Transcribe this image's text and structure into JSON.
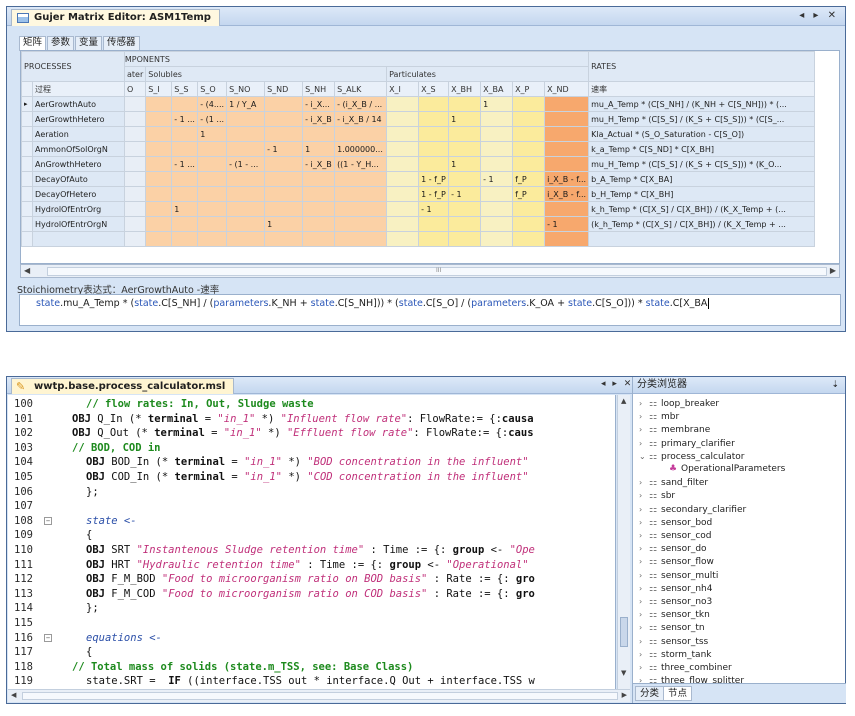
{
  "matrix_editor": {
    "title": "Gujer Matrix Editor: ASM1Temp",
    "window_controls": "◂ ▸ ✕",
    "tabs": [
      "矩阵",
      "参数",
      "变量",
      "传感器"
    ],
    "header_components": "COMPONENTS",
    "header_processes": "PROCESSES",
    "header_rates": "RATES",
    "group_water": "ater",
    "group_solubles": "Solubles",
    "group_particulates": "Particulates",
    "process_col_label": "过程",
    "rate_col_label": "速率",
    "columns": [
      "O",
      "S_I",
      "S_S",
      "S_O",
      "S_NO",
      "S_ND",
      "S_NH",
      "S_ALK",
      "X_I",
      "X_S",
      "X_BH",
      "X_BA",
      "X_P",
      "X_ND"
    ],
    "rows": [
      {
        "process": "AerGrowthAuto",
        "cells": [
          "",
          "",
          "",
          "- (4....",
          "1 / Y_A",
          "",
          "- i_X...",
          "- (i_X_B / ...",
          "",
          "",
          "",
          "1",
          "",
          ""
        ],
        "rate": "mu_A_Temp * (C[S_NH] / (K_NH + C[S_NH])) * (...",
        "current": true
      },
      {
        "process": "AerGrowthHetero",
        "cells": [
          "",
          "",
          "- 1 ...",
          "- (1 ...",
          "",
          "",
          "- i_X_B",
          "- i_X_B / 14",
          "",
          "",
          "1",
          "",
          "",
          ""
        ],
        "rate": "mu_H_Temp * (C[S_S] / (K_S + C[S_S])) * (C[S_...",
        "current": false
      },
      {
        "process": "Aeration",
        "cells": [
          "",
          "",
          "",
          "1",
          "",
          "",
          "",
          "",
          "",
          "",
          "",
          "",
          "",
          ""
        ],
        "rate": "Kla_Actual * (S_O_Saturation - C[S_O])",
        "current": false
      },
      {
        "process": "AmmonOfSolOrgN",
        "cells": [
          "",
          "",
          "",
          "",
          "",
          "- 1",
          "1",
          "1.000000...",
          "",
          "",
          "",
          "",
          "",
          ""
        ],
        "rate": "k_a_Temp * C[S_ND] * C[X_BH]",
        "current": false
      },
      {
        "process": "AnGrowthHetero",
        "cells": [
          "",
          "",
          "- 1 ...",
          "",
          "- (1 - ...",
          "",
          "- i_X_B",
          "((1 - Y_H...",
          "",
          "",
          "1",
          "",
          "",
          ""
        ],
        "rate": "mu_H_Temp * (C[S_S] / (K_S + C[S_S])) * (K_O...",
        "current": false
      },
      {
        "process": "DecayOfAuto",
        "cells": [
          "",
          "",
          "",
          "",
          "",
          "",
          "",
          "",
          "",
          "1 - f_P",
          "",
          "- 1",
          "f_P",
          "i_X_B - f..."
        ],
        "rate": "b_A_Temp * C[X_BA]",
        "current": false
      },
      {
        "process": "DecayOfHetero",
        "cells": [
          "",
          "",
          "",
          "",
          "",
          "",
          "",
          "",
          "",
          "1 - f_P",
          "- 1",
          "",
          "f_P",
          "i_X_B - f..."
        ],
        "rate": "b_H_Temp * C[X_BH]",
        "current": false
      },
      {
        "process": "HydrolOfEntrOrg",
        "cells": [
          "",
          "",
          "1",
          "",
          "",
          "",
          "",
          "",
          "",
          "- 1",
          "",
          "",
          "",
          ""
        ],
        "rate": "k_h_Temp * (C[X_S] / C[X_BH]) / (K_X_Temp + (...",
        "current": false
      },
      {
        "process": "HydrolOfEntrOrgN",
        "cells": [
          "",
          "",
          "",
          "",
          "",
          "1",
          "",
          "",
          "",
          "",
          "",
          "",
          "",
          "- 1"
        ],
        "rate": "(k_h_Temp * (C[X_S] / C[X_BH]) / (K_X_Temp + ...",
        "current": false
      }
    ],
    "scroll_mark": "III",
    "stoich_label": "Stoichiometry表达式：AerGrowthAuto -速率",
    "formula_parts": [
      {
        "t": "state",
        "kw": true
      },
      {
        "t": ".mu_A_Temp * (",
        "kw": false
      },
      {
        "t": "state",
        "kw": true
      },
      {
        "t": ".C[S_NH] / (",
        "kw": false
      },
      {
        "t": "parameters",
        "kw": true
      },
      {
        "t": ".K_NH + ",
        "kw": false
      },
      {
        "t": "state",
        "kw": true
      },
      {
        "t": ".C[S_NH])) * (",
        "kw": false
      },
      {
        "t": "state",
        "kw": true
      },
      {
        "t": ".C[S_O] / (",
        "kw": false
      },
      {
        "t": "parameters",
        "kw": true
      },
      {
        "t": ".K_OA + ",
        "kw": false
      },
      {
        "t": "state",
        "kw": true
      },
      {
        "t": ".C[S_O])) * ",
        "kw": false
      },
      {
        "t": "state",
        "kw": true
      },
      {
        "t": ".C[X_BA",
        "kw": false
      }
    ]
  },
  "code_editor": {
    "file_tab": "wwtp.base.process_calculator.msl",
    "controls": "◂ ▸ ✕",
    "lines": [
      {
        "n": "100",
        "indent": 1,
        "fold": false,
        "segs": [
          [
            "cm",
            "// flow rates: In, Out, Sludge waste"
          ]
        ]
      },
      {
        "n": "101",
        "indent": 0,
        "fold": false,
        "segs": [
          [
            "k",
            "OBJ"
          ],
          [
            "pl",
            " Q_In (* "
          ],
          [
            "k",
            "terminal"
          ],
          [
            "pl",
            " = "
          ],
          [
            "st",
            "\"in_1\""
          ],
          [
            "pl",
            " *) "
          ],
          [
            "st",
            "\"Influent flow rate\""
          ],
          [
            "pl",
            ": FlowRate:= {:"
          ],
          [
            "k",
            "causa"
          ]
        ]
      },
      {
        "n": "102",
        "indent": 0,
        "fold": false,
        "segs": [
          [
            "k",
            "OBJ"
          ],
          [
            "pl",
            " Q_Out (* "
          ],
          [
            "k",
            "terminal"
          ],
          [
            "pl",
            " = "
          ],
          [
            "st",
            "\"in_1\""
          ],
          [
            "pl",
            " *) "
          ],
          [
            "st",
            "\"Effluent flow rate\""
          ],
          [
            "pl",
            ": FlowRate:= {:"
          ],
          [
            "k",
            "caus"
          ]
        ]
      },
      {
        "n": "103",
        "indent": 0,
        "fold": false,
        "segs": [
          [
            "cm",
            "// BOD, COD in"
          ]
        ]
      },
      {
        "n": "104",
        "indent": 1,
        "fold": false,
        "segs": [
          [
            "k",
            "OBJ"
          ],
          [
            "pl",
            " BOD_In (* "
          ],
          [
            "k",
            "terminal"
          ],
          [
            "pl",
            " = "
          ],
          [
            "st",
            "\"in_1\""
          ],
          [
            "pl",
            " *) "
          ],
          [
            "st",
            "\"BOD concentration in the influent\""
          ]
        ]
      },
      {
        "n": "105",
        "indent": 1,
        "fold": false,
        "segs": [
          [
            "k",
            "OBJ"
          ],
          [
            "pl",
            " COD_In (* "
          ],
          [
            "k",
            "terminal"
          ],
          [
            "pl",
            " = "
          ],
          [
            "st",
            "\"in_1\""
          ],
          [
            "pl",
            " *) "
          ],
          [
            "st",
            "\"COD concentration in the influent\""
          ]
        ]
      },
      {
        "n": "106",
        "indent": 1,
        "fold": false,
        "segs": [
          [
            "pl",
            "};"
          ]
        ]
      },
      {
        "n": "107",
        "indent": 0,
        "fold": false,
        "segs": []
      },
      {
        "n": "108",
        "indent": 1,
        "fold": true,
        "segs": [
          [
            "it",
            "state <-"
          ]
        ]
      },
      {
        "n": "109",
        "indent": 1,
        "fold": false,
        "segs": [
          [
            "pl",
            "{"
          ]
        ]
      },
      {
        "n": "110",
        "indent": 1,
        "fold": false,
        "segs": [
          [
            "k",
            "OBJ"
          ],
          [
            "pl",
            " SRT "
          ],
          [
            "st",
            "\"Instantenous Sludge retention time\""
          ],
          [
            "pl",
            " : Time := {: "
          ],
          [
            "k",
            "group"
          ],
          [
            "pl",
            " <- "
          ],
          [
            "st",
            "\"Ope"
          ]
        ]
      },
      {
        "n": "111",
        "indent": 1,
        "fold": false,
        "segs": [
          [
            "k",
            "OBJ"
          ],
          [
            "pl",
            " HRT "
          ],
          [
            "st",
            "\"Hydraulic retention time\""
          ],
          [
            "pl",
            " : Time := {: "
          ],
          [
            "k",
            "group"
          ],
          [
            "pl",
            " <- "
          ],
          [
            "st",
            "\"Operational\""
          ]
        ]
      },
      {
        "n": "112",
        "indent": 1,
        "fold": false,
        "segs": [
          [
            "k",
            "OBJ"
          ],
          [
            "pl",
            " F_M_BOD "
          ],
          [
            "st",
            "\"Food to microorganism ratio on BOD basis\""
          ],
          [
            "pl",
            " : Rate := {: "
          ],
          [
            "k",
            "gro"
          ]
        ]
      },
      {
        "n": "113",
        "indent": 1,
        "fold": false,
        "segs": [
          [
            "k",
            "OBJ"
          ],
          [
            "pl",
            " F_M_COD "
          ],
          [
            "st",
            "\"Food to microorganism ratio on COD basis\""
          ],
          [
            "pl",
            " : Rate := {: "
          ],
          [
            "k",
            "gro"
          ]
        ]
      },
      {
        "n": "114",
        "indent": 1,
        "fold": false,
        "segs": [
          [
            "pl",
            "};"
          ]
        ]
      },
      {
        "n": "115",
        "indent": 0,
        "fold": false,
        "segs": []
      },
      {
        "n": "116",
        "indent": 1,
        "fold": true,
        "segs": [
          [
            "it",
            "equations <-"
          ]
        ]
      },
      {
        "n": "117",
        "indent": 1,
        "fold": false,
        "segs": [
          [
            "pl",
            "{"
          ]
        ]
      },
      {
        "n": "118",
        "indent": 0,
        "fold": false,
        "segs": [
          [
            "cm",
            "// Total mass of solids (state.m_TSS, see: Base Class)"
          ]
        ]
      },
      {
        "n": "119",
        "indent": 1,
        "fold": false,
        "segs": [
          [
            "pl",
            "state.SRT =  "
          ],
          [
            "k",
            "IF"
          ],
          [
            "pl",
            " ((interface.TSS out * interface.Q Out + interface.TSS w"
          ]
        ]
      }
    ]
  },
  "class_browser": {
    "title": "分类浏览器",
    "pin": "⇣",
    "nodes": [
      {
        "label": "loop_breaker",
        "child": false,
        "expanded": false
      },
      {
        "label": "mbr",
        "child": false,
        "expanded": false
      },
      {
        "label": "membrane",
        "child": false,
        "expanded": false
      },
      {
        "label": "primary_clarifier",
        "child": false,
        "expanded": false
      },
      {
        "label": "process_calculator",
        "child": false,
        "expanded": true
      },
      {
        "label": "OperationalParameters",
        "child": true,
        "expanded": false
      },
      {
        "label": "sand_filter",
        "child": false,
        "expanded": false
      },
      {
        "label": "sbr",
        "child": false,
        "expanded": false
      },
      {
        "label": "secondary_clarifier",
        "child": false,
        "expanded": false
      },
      {
        "label": "sensor_bod",
        "child": false,
        "expanded": false
      },
      {
        "label": "sensor_cod",
        "child": false,
        "expanded": false
      },
      {
        "label": "sensor_do",
        "child": false,
        "expanded": false
      },
      {
        "label": "sensor_flow",
        "child": false,
        "expanded": false
      },
      {
        "label": "sensor_multi",
        "child": false,
        "expanded": false
      },
      {
        "label": "sensor_nh4",
        "child": false,
        "expanded": false
      },
      {
        "label": "sensor_no3",
        "child": false,
        "expanded": false
      },
      {
        "label": "sensor_tkn",
        "child": false,
        "expanded": false
      },
      {
        "label": "sensor_tn",
        "child": false,
        "expanded": false
      },
      {
        "label": "sensor_tss",
        "child": false,
        "expanded": false
      },
      {
        "label": "storm_tank",
        "child": false,
        "expanded": false
      },
      {
        "label": "three_combiner",
        "child": false,
        "expanded": false
      },
      {
        "label": "three_flow_splitter",
        "child": false,
        "expanded": false
      }
    ],
    "bottom_tabs": [
      "分类",
      "节点"
    ]
  },
  "colors": {
    "water": "#e8eef6",
    "solubles": "#fbd1a6",
    "particulates": "#fbeb9c",
    "nd_column": "#f7a86d",
    "keyword_blue": "#2b57b8",
    "comment_green": "#1d8a1d",
    "string_magenta": "#c0307a"
  }
}
